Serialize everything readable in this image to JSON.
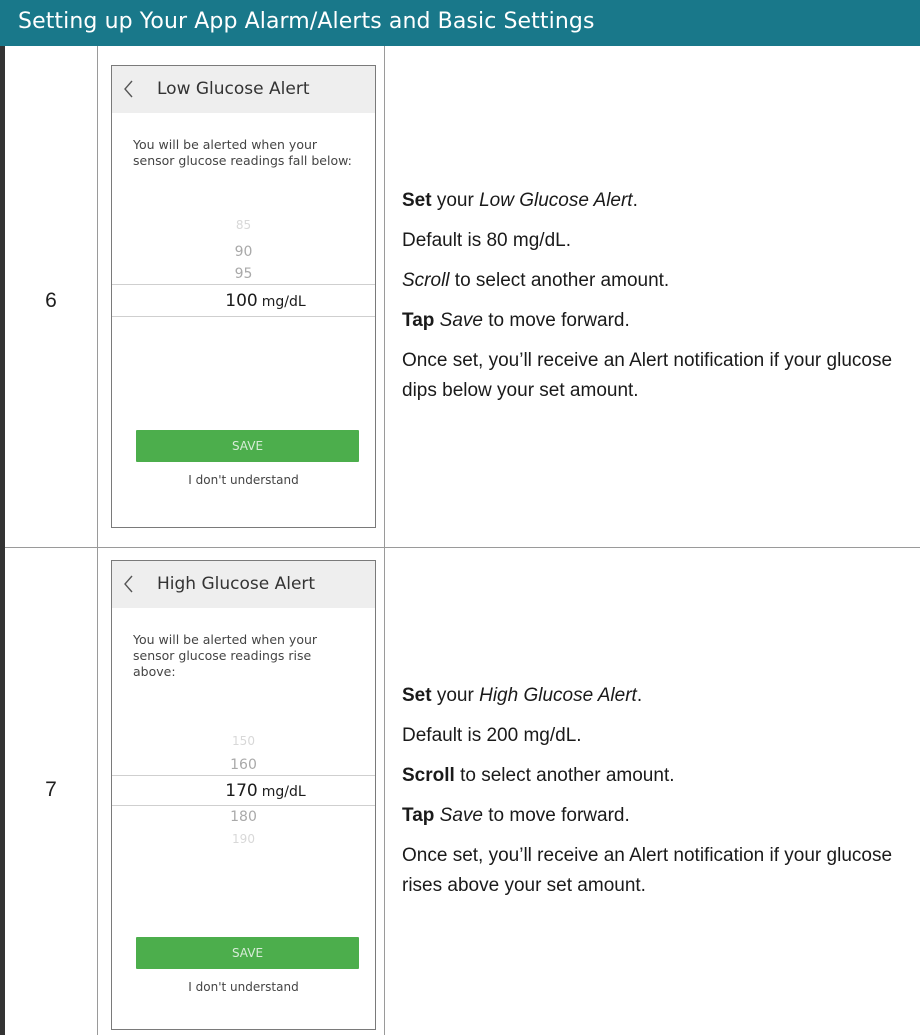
{
  "header": {
    "title": "Setting up Your App Alarm/Alerts and Basic Settings"
  },
  "steps": [
    {
      "number": "6",
      "phone": {
        "title": "Low Glucose Alert",
        "description": "You will be alerted when your sensor glucose readings fall below:",
        "picker": {
          "faint_above": "85",
          "above_2": "90",
          "above_1": "95",
          "selected_value": "100",
          "unit": "mg/dL"
        },
        "save_label": "SAVE",
        "help_link": "I don't understand"
      },
      "instructions": {
        "line1": {
          "bold": "Set",
          "plain": " your ",
          "italic": "Low Glucose Alert",
          "end": "."
        },
        "line2": "Default is 80 mg/dL.",
        "line3": {
          "italic": "Scroll",
          "plain": " to select another amount."
        },
        "line4": {
          "bold": "Tap",
          "italic": "Save",
          "plain": " to move forward."
        },
        "line5": "Once set, you’ll receive an Alert notification if your glucose dips below your set amount."
      }
    },
    {
      "number": "7",
      "phone": {
        "title": "High Glucose Alert",
        "description": "You will be alerted when your sensor glucose readings rise above:",
        "picker": {
          "faint_above": "150",
          "above_1": "160",
          "selected_value": "170",
          "unit": "mg/dL",
          "below_1": "180",
          "faint_below": "190"
        },
        "save_label": "SAVE",
        "help_link": "I don't understand"
      },
      "instructions": {
        "line1": {
          "bold": "Set",
          "plain": " your ",
          "italic": "High Glucose Alert",
          "end": "."
        },
        "line2": "Default is 200 mg/dL.",
        "line3": {
          "bold": "Scroll",
          "plain": " to select another amount."
        },
        "line4": {
          "bold": "Tap",
          "italic": "Save",
          "plain": " to move forward."
        },
        "line5": "Once set, you’ll receive an Alert notification if your glucose rises above your set amount."
      }
    }
  ]
}
